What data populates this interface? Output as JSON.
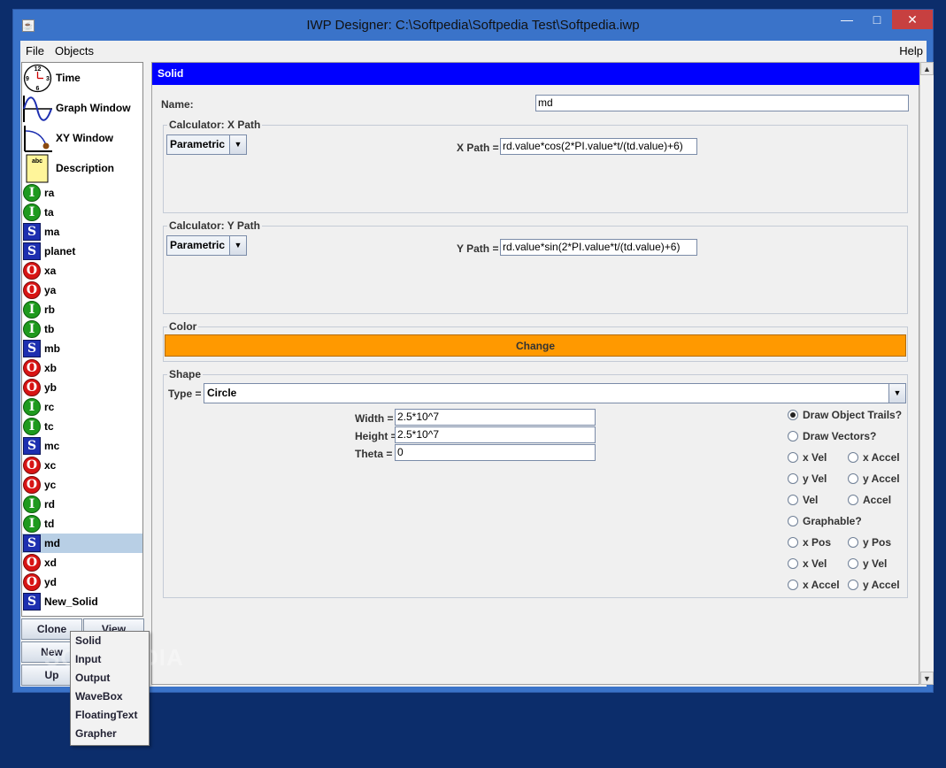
{
  "window": {
    "title": "IWP Designer: C:\\Softpedia\\Softpedia Test\\Softpedia.iwp",
    "icon": "java-icon"
  },
  "menu": {
    "file": "File",
    "objects": "Objects",
    "help": "Help"
  },
  "palette": {
    "tools": [
      {
        "label": "Time",
        "icon": "clock-icon",
        "clock": {
          "n12": "12",
          "n3": "3",
          "n6": "6",
          "n9": "9"
        }
      },
      {
        "label": "Graph Window",
        "icon": "sine-wave-icon"
      },
      {
        "label": "XY Window",
        "icon": "xy-path-icon"
      },
      {
        "label": "Description",
        "icon": "notepad-icon",
        "icon_text": "abc"
      }
    ],
    "objects": [
      {
        "type": "I",
        "label": "ra"
      },
      {
        "type": "I",
        "label": "ta"
      },
      {
        "type": "S",
        "label": "ma"
      },
      {
        "type": "S",
        "label": "planet"
      },
      {
        "type": "O",
        "label": "xa"
      },
      {
        "type": "O",
        "label": "ya"
      },
      {
        "type": "I",
        "label": "rb"
      },
      {
        "type": "I",
        "label": "tb"
      },
      {
        "type": "S",
        "label": "mb"
      },
      {
        "type": "O",
        "label": "xb"
      },
      {
        "type": "O",
        "label": "yb"
      },
      {
        "type": "I",
        "label": "rc"
      },
      {
        "type": "I",
        "label": "tc"
      },
      {
        "type": "S",
        "label": "mc"
      },
      {
        "type": "O",
        "label": "xc"
      },
      {
        "type": "O",
        "label": "yc"
      },
      {
        "type": "I",
        "label": "rd"
      },
      {
        "type": "I",
        "label": "td"
      },
      {
        "type": "S",
        "label": "md",
        "selected": true
      },
      {
        "type": "O",
        "label": "xd"
      },
      {
        "type": "O",
        "label": "yd"
      },
      {
        "type": "S",
        "label": "New_Solid"
      }
    ],
    "buttons": {
      "clone": "Clone",
      "view": "View",
      "new": "New",
      "up": "Up"
    }
  },
  "popup_menu": [
    "Solid",
    "Input",
    "Output",
    "WaveBox",
    "FloatingText",
    "Grapher"
  ],
  "watermark": "SOFTPEDIA",
  "editor": {
    "header": "Solid",
    "name_label": "Name:",
    "name_value": "md",
    "x_path": {
      "group": "Calculator: X Path",
      "mode": "Parametric",
      "label": "X Path =",
      "value": "rd.value*cos(2*PI.value*t/(td.value)+6)"
    },
    "y_path": {
      "group": "Calculator: Y Path",
      "mode": "Parametric",
      "label": "Y Path =",
      "value": "rd.value*sin(2*PI.value*t/(td.value)+6)"
    },
    "color": {
      "group": "Color",
      "button": "Change",
      "swatch": "#ff9900"
    },
    "shape": {
      "group": "Shape",
      "type_label": "Type =",
      "type_value": "Circle",
      "width_label": "Width =",
      "width_value": "2.5*10^7",
      "height_label": "Height =",
      "height_value": "2.5*10^7",
      "theta_label": "Theta =",
      "theta_value": "0"
    },
    "options": {
      "draw_trails": {
        "label": "Draw Object Trails?",
        "checked": true
      },
      "draw_vectors": {
        "label": "Draw Vectors?",
        "checked": false
      },
      "x_vel": "x Vel",
      "x_accel": "x Accel",
      "y_vel": "y Vel",
      "y_accel": "y Accel",
      "vel": "Vel",
      "accel": "Accel",
      "graphable": {
        "label": "Graphable?",
        "checked": false
      },
      "g_x_pos": "x Pos",
      "g_y_pos": "y Pos",
      "g_x_vel": "x Vel",
      "g_y_vel": "y Vel",
      "g_x_accel": "x Accel",
      "g_y_accel": "y Accel"
    }
  }
}
